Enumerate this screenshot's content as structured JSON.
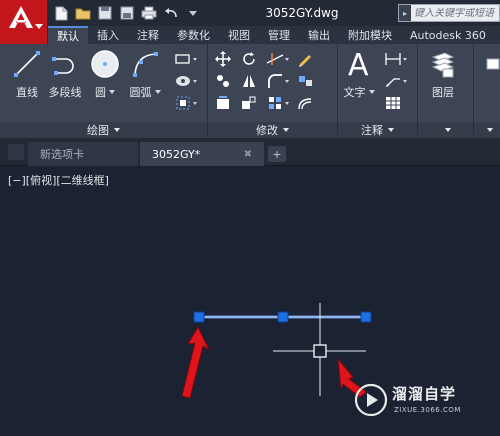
{
  "title_bar": {
    "document_title": "3052GY.dwg",
    "search_placeholder": "键入关键字或短语"
  },
  "ribbon_tabs": [
    "默认",
    "插入",
    "注释",
    "参数化",
    "视图",
    "管理",
    "输出",
    "附加模块",
    "Autodesk 360"
  ],
  "active_tab": "默认",
  "panels": {
    "draw": {
      "title": "绘图",
      "tools": [
        "直线",
        "多段线",
        "圆",
        "圆弧"
      ]
    },
    "modify": {
      "title": "修改"
    },
    "annotation": {
      "title": "注释",
      "text_tool": "文字"
    },
    "layers": {
      "tool": "图层"
    }
  },
  "file_tabs": {
    "new_tab": "新选项卡",
    "doc_tab": "3052GY*"
  },
  "viewport": {
    "label": "[−][俯视][二维线框]"
  },
  "watermark": {
    "title": "溜溜自学",
    "url": "ZIXUE.3066.COM"
  },
  "colors": {
    "brand_red": "#c3161c",
    "canvas_bg": "#1b2232",
    "line_blue": "#5b8dd6",
    "grip_blue": "#1e6fe6",
    "arrow_red": "#e0141c"
  }
}
